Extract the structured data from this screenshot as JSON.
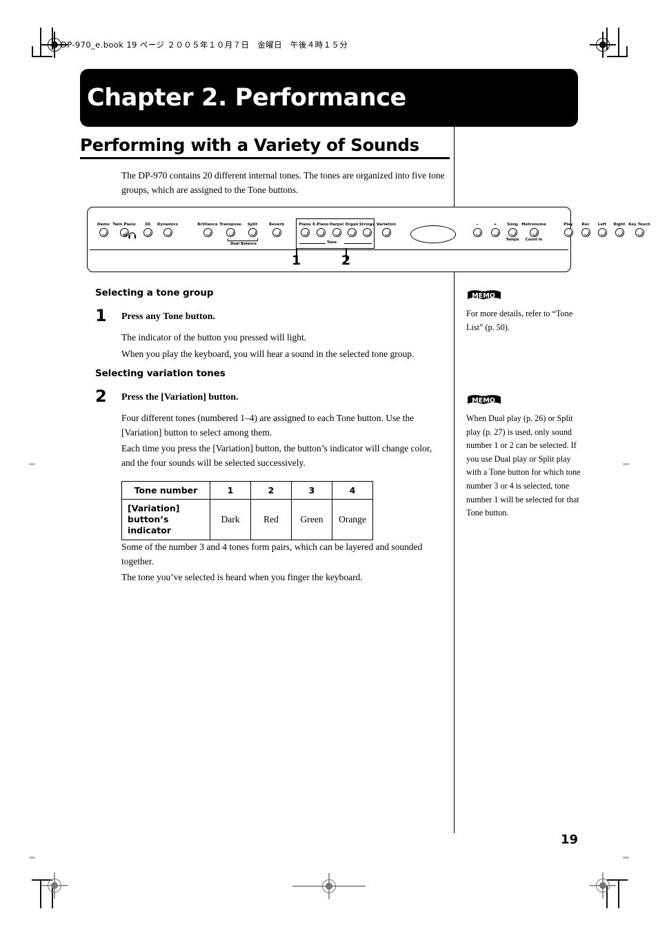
{
  "print": {
    "file_info": "DP-970_e.book  19 ページ  ２００５年１０月７日　金曜日　午後４時１５分"
  },
  "chapter": {
    "title": "Chapter 2. Performance"
  },
  "section": {
    "title": "Performing with a Variety of Sounds",
    "intro": "The DP-970 contains 20 different internal tones. The tones are organized into five tone groups, which are assigned to the Tone buttons."
  },
  "panel": {
    "left_controls": [
      {
        "label": "Demo"
      },
      {
        "label": "Twin Piano"
      },
      {
        "label": "3D"
      },
      {
        "label": "Dynamics"
      },
      {
        "label": "Brilliance"
      },
      {
        "label": "Transpose"
      },
      {
        "label": "Split"
      }
    ],
    "dual_balance_label": "Dual Balance",
    "reverb_label": "Reverb",
    "tone_caption": "Tone",
    "tone_buttons": [
      {
        "label": "Piano"
      },
      {
        "label": "E.Piano"
      },
      {
        "label": "Harpsi"
      },
      {
        "label": "Organ"
      },
      {
        "label": "Strings"
      }
    ],
    "variation_label": "Variation",
    "right_controls": [
      {
        "label": "−",
        "sub": ""
      },
      {
        "label": "+",
        "sub": ""
      },
      {
        "label": "Song",
        "sub": "Tempo"
      },
      {
        "label": "Metronome",
        "sub": "Count In"
      },
      {
        "label": "Play",
        "sub": ""
      },
      {
        "label": "Rec",
        "sub": ""
      },
      {
        "label": "Left",
        "sub": ""
      },
      {
        "label": "Right",
        "sub": ""
      },
      {
        "label": "Key Touch",
        "sub": ""
      }
    ],
    "callouts": [
      {
        "num": "1"
      },
      {
        "num": "2"
      }
    ]
  },
  "steps": [
    {
      "heading": "Selecting a tone group",
      "number": "1",
      "title": "Press any Tone button.",
      "paragraphs": [
        "The indicator of the button you pressed will light.",
        "When you play the keyboard, you will hear a sound in the selected tone group."
      ]
    },
    {
      "heading": "Selecting variation tones",
      "number": "2",
      "title": "Press the [Variation] button.",
      "paragraphs": [
        "Four different tones (numbered 1–4) are assigned to each Tone button. Use the [Variation] button to select among them.",
        "Each time you press the [Variation] button, the button’s indicator will change color, and the four sounds will be selected successively."
      ],
      "after_table_paragraphs": [
        "Some of the number 3 and 4 tones form pairs, which can be layered and sounded together.",
        "The tone you’ve selected is heard when you finger the keyboard."
      ]
    }
  ],
  "table": {
    "header_label": "Tone number",
    "header_values": [
      "1",
      "2",
      "3",
      "4"
    ],
    "row_label_line1": "[Variation]",
    "row_label_line2": "button’s indicator",
    "row_values": [
      "Dark",
      "Red",
      "Green",
      "Orange"
    ]
  },
  "memos": [
    {
      "icon_label": "MEMO",
      "text": "For more details, refer to “Tone List” (p. 50)."
    },
    {
      "icon_label": "MEMO",
      "text": "When Dual play (p. 26) or Split play (p. 27) is used, only sound number 1 or 2 can be selected. If you use Dual play or Split play with a Tone button for which tone number 3 or 4 is selected, tone number 1 will be selected for that Tone button."
    }
  ],
  "page": {
    "number": "19"
  }
}
